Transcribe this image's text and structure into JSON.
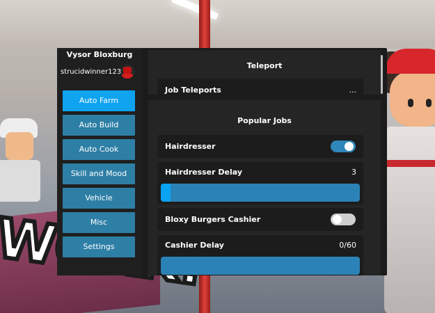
{
  "gui": {
    "title": "Vysor Bloxburg",
    "username": "strucidwinner123",
    "nav": [
      {
        "label": "Auto Farm",
        "active": true
      },
      {
        "label": "Auto Build",
        "active": false
      },
      {
        "label": "Auto Cook",
        "active": false
      },
      {
        "label": "Skill and Mood",
        "active": false
      },
      {
        "label": "Vehicle",
        "active": false
      },
      {
        "label": "Misc",
        "active": false
      },
      {
        "label": "Settings",
        "active": false
      }
    ]
  },
  "teleport": {
    "title": "Teleport",
    "job_teleports": {
      "label": "Job Teleports",
      "value": "..."
    }
  },
  "jobs": {
    "title": "Popular Jobs",
    "hairdresser": {
      "label": "Hairdresser",
      "enabled": true
    },
    "hairdresser_delay": {
      "label": "Hairdresser Delay",
      "value": "3",
      "fill_fraction": 0.05
    },
    "cashier": {
      "label": "Bloxy Burgers Cashier",
      "enabled": false
    },
    "cashier_delay": {
      "label": "Cashier Delay",
      "value": "0/60",
      "fill_fraction": 0
    }
  },
  "background": {
    "painted_text": "WORK!"
  },
  "colors": {
    "accent": "#0fa3f0",
    "button": "#2e7fa6",
    "panel": "#1b1b1b",
    "toggle_on": "#2f86b8",
    "toggle_off": "#cfcfcf"
  }
}
